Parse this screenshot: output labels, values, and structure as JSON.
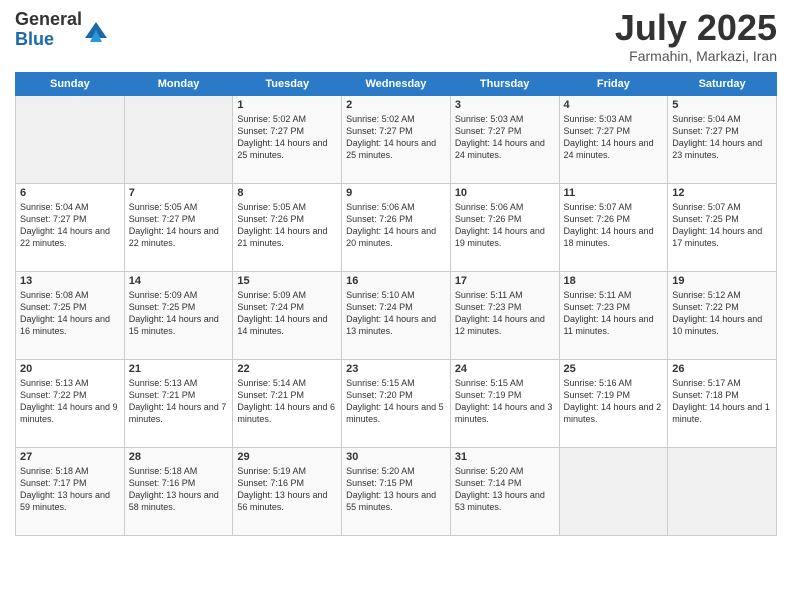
{
  "header": {
    "logo_general": "General",
    "logo_blue": "Blue",
    "month_title": "July 2025",
    "location": "Farmahin, Markazi, Iran"
  },
  "weekdays": [
    "Sunday",
    "Monday",
    "Tuesday",
    "Wednesday",
    "Thursday",
    "Friday",
    "Saturday"
  ],
  "weeks": [
    [
      {
        "day": "",
        "sunrise": "",
        "sunset": "",
        "daylight": ""
      },
      {
        "day": "",
        "sunrise": "",
        "sunset": "",
        "daylight": ""
      },
      {
        "day": "1",
        "sunrise": "Sunrise: 5:02 AM",
        "sunset": "Sunset: 7:27 PM",
        "daylight": "Daylight: 14 hours and 25 minutes."
      },
      {
        "day": "2",
        "sunrise": "Sunrise: 5:02 AM",
        "sunset": "Sunset: 7:27 PM",
        "daylight": "Daylight: 14 hours and 25 minutes."
      },
      {
        "day": "3",
        "sunrise": "Sunrise: 5:03 AM",
        "sunset": "Sunset: 7:27 PM",
        "daylight": "Daylight: 14 hours and 24 minutes."
      },
      {
        "day": "4",
        "sunrise": "Sunrise: 5:03 AM",
        "sunset": "Sunset: 7:27 PM",
        "daylight": "Daylight: 14 hours and 24 minutes."
      },
      {
        "day": "5",
        "sunrise": "Sunrise: 5:04 AM",
        "sunset": "Sunset: 7:27 PM",
        "daylight": "Daylight: 14 hours and 23 minutes."
      }
    ],
    [
      {
        "day": "6",
        "sunrise": "Sunrise: 5:04 AM",
        "sunset": "Sunset: 7:27 PM",
        "daylight": "Daylight: 14 hours and 22 minutes."
      },
      {
        "day": "7",
        "sunrise": "Sunrise: 5:05 AM",
        "sunset": "Sunset: 7:27 PM",
        "daylight": "Daylight: 14 hours and 22 minutes."
      },
      {
        "day": "8",
        "sunrise": "Sunrise: 5:05 AM",
        "sunset": "Sunset: 7:26 PM",
        "daylight": "Daylight: 14 hours and 21 minutes."
      },
      {
        "day": "9",
        "sunrise": "Sunrise: 5:06 AM",
        "sunset": "Sunset: 7:26 PM",
        "daylight": "Daylight: 14 hours and 20 minutes."
      },
      {
        "day": "10",
        "sunrise": "Sunrise: 5:06 AM",
        "sunset": "Sunset: 7:26 PM",
        "daylight": "Daylight: 14 hours and 19 minutes."
      },
      {
        "day": "11",
        "sunrise": "Sunrise: 5:07 AM",
        "sunset": "Sunset: 7:26 PM",
        "daylight": "Daylight: 14 hours and 18 minutes."
      },
      {
        "day": "12",
        "sunrise": "Sunrise: 5:07 AM",
        "sunset": "Sunset: 7:25 PM",
        "daylight": "Daylight: 14 hours and 17 minutes."
      }
    ],
    [
      {
        "day": "13",
        "sunrise": "Sunrise: 5:08 AM",
        "sunset": "Sunset: 7:25 PM",
        "daylight": "Daylight: 14 hours and 16 minutes."
      },
      {
        "day": "14",
        "sunrise": "Sunrise: 5:09 AM",
        "sunset": "Sunset: 7:25 PM",
        "daylight": "Daylight: 14 hours and 15 minutes."
      },
      {
        "day": "15",
        "sunrise": "Sunrise: 5:09 AM",
        "sunset": "Sunset: 7:24 PM",
        "daylight": "Daylight: 14 hours and 14 minutes."
      },
      {
        "day": "16",
        "sunrise": "Sunrise: 5:10 AM",
        "sunset": "Sunset: 7:24 PM",
        "daylight": "Daylight: 14 hours and 13 minutes."
      },
      {
        "day": "17",
        "sunrise": "Sunrise: 5:11 AM",
        "sunset": "Sunset: 7:23 PM",
        "daylight": "Daylight: 14 hours and 12 minutes."
      },
      {
        "day": "18",
        "sunrise": "Sunrise: 5:11 AM",
        "sunset": "Sunset: 7:23 PM",
        "daylight": "Daylight: 14 hours and 11 minutes."
      },
      {
        "day": "19",
        "sunrise": "Sunrise: 5:12 AM",
        "sunset": "Sunset: 7:22 PM",
        "daylight": "Daylight: 14 hours and 10 minutes."
      }
    ],
    [
      {
        "day": "20",
        "sunrise": "Sunrise: 5:13 AM",
        "sunset": "Sunset: 7:22 PM",
        "daylight": "Daylight: 14 hours and 9 minutes."
      },
      {
        "day": "21",
        "sunrise": "Sunrise: 5:13 AM",
        "sunset": "Sunset: 7:21 PM",
        "daylight": "Daylight: 14 hours and 7 minutes."
      },
      {
        "day": "22",
        "sunrise": "Sunrise: 5:14 AM",
        "sunset": "Sunset: 7:21 PM",
        "daylight": "Daylight: 14 hours and 6 minutes."
      },
      {
        "day": "23",
        "sunrise": "Sunrise: 5:15 AM",
        "sunset": "Sunset: 7:20 PM",
        "daylight": "Daylight: 14 hours and 5 minutes."
      },
      {
        "day": "24",
        "sunrise": "Sunrise: 5:15 AM",
        "sunset": "Sunset: 7:19 PM",
        "daylight": "Daylight: 14 hours and 3 minutes."
      },
      {
        "day": "25",
        "sunrise": "Sunrise: 5:16 AM",
        "sunset": "Sunset: 7:19 PM",
        "daylight": "Daylight: 14 hours and 2 minutes."
      },
      {
        "day": "26",
        "sunrise": "Sunrise: 5:17 AM",
        "sunset": "Sunset: 7:18 PM",
        "daylight": "Daylight: 14 hours and 1 minute."
      }
    ],
    [
      {
        "day": "27",
        "sunrise": "Sunrise: 5:18 AM",
        "sunset": "Sunset: 7:17 PM",
        "daylight": "Daylight: 13 hours and 59 minutes."
      },
      {
        "day": "28",
        "sunrise": "Sunrise: 5:18 AM",
        "sunset": "Sunset: 7:16 PM",
        "daylight": "Daylight: 13 hours and 58 minutes."
      },
      {
        "day": "29",
        "sunrise": "Sunrise: 5:19 AM",
        "sunset": "Sunset: 7:16 PM",
        "daylight": "Daylight: 13 hours and 56 minutes."
      },
      {
        "day": "30",
        "sunrise": "Sunrise: 5:20 AM",
        "sunset": "Sunset: 7:15 PM",
        "daylight": "Daylight: 13 hours and 55 minutes."
      },
      {
        "day": "31",
        "sunrise": "Sunrise: 5:20 AM",
        "sunset": "Sunset: 7:14 PM",
        "daylight": "Daylight: 13 hours and 53 minutes."
      },
      {
        "day": "",
        "sunrise": "",
        "sunset": "",
        "daylight": ""
      },
      {
        "day": "",
        "sunrise": "",
        "sunset": "",
        "daylight": ""
      }
    ]
  ]
}
